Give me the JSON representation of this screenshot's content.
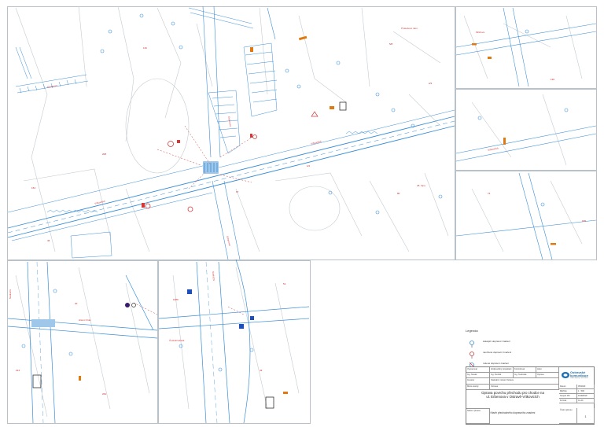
{
  "map": {
    "street_labels": [
      "Erbenova",
      "Erbenova",
      "Erbenova",
      "Vítkovická",
      "Vítkovická",
      "Vítkovická",
      "Nádražní",
      "Nádražní",
      "Prokešovo nám.",
      "Hlavní třída",
      "28. října",
      "Českobratrská",
      "Milíčova"
    ],
    "parcel_numbers": [
      "116",
      "154",
      "208",
      "1/2",
      "2/3",
      "5/8",
      "46",
      "67",
      "80",
      "136",
      "155",
      "20",
      "214",
      "264",
      "1080",
      "51",
      "43",
      "74"
    ],
    "colors": {
      "road": "#3a8fd8",
      "text": "#d23a3a",
      "grey": "#b9c2c8",
      "sign": "#e07a10",
      "dark": "#333333"
    }
  },
  "legend": {
    "title": "Legenda",
    "items": [
      {
        "label": "stávající dopravní značení",
        "icon": "blue-sign-icon"
      },
      {
        "label": "navržené dopravní značení",
        "icon": "red-sign-icon"
      },
      {
        "label": "rušené dopravní značení",
        "icon": "crossed-sign-icon"
      }
    ]
  },
  "title_block": {
    "header_cells": [
      "Vypracoval",
      "Zodpovědný projektant",
      "Kontroloval",
      "Akce"
    ],
    "header_values": [
      "Ing. Novák",
      "Ing. Dvořák",
      "Ing. Svoboda",
      "Oprava"
    ],
    "investor_label": "Investor",
    "investor_value": "Statutární město Ostrava",
    "place_label": "Místo stavby",
    "place_value": "Ostrava",
    "title_line1": "Oprava povrchu přechodu pro chodce na",
    "title_line2": "ul. Erbenova v Ostravě-Vítkovicích",
    "drawing_label": "Název výkresu",
    "drawing_name": "Návrh přechodného dopravního značení",
    "right_cells": [
      "Datum",
      "05/2023",
      "Měřítko",
      "1 : 500",
      "Stupeň PD",
      "DUR/DSP",
      "Formát",
      "4x A4"
    ],
    "sheet_label": "Číslo výkresu",
    "sheet_value": "1",
    "logo_name": "Ostravské komunikace",
    "logo_sub": "Odbor dopravy a komunikací"
  }
}
